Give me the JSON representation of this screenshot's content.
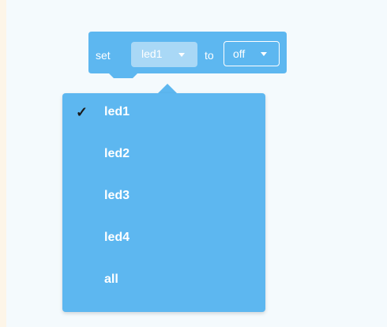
{
  "block": {
    "set_label": "set",
    "to_label": "to",
    "selected_value": "led1",
    "state_value": "off"
  },
  "dropdown": {
    "items": [
      {
        "label": "led1",
        "checked": true
      },
      {
        "label": "led2",
        "checked": false
      },
      {
        "label": "led3",
        "checked": false
      },
      {
        "label": "led4",
        "checked": false
      },
      {
        "label": "all",
        "checked": false
      }
    ],
    "check_glyph": "✓"
  },
  "colors": {
    "block": "#5db7f0",
    "selected_field": "#a9d8f6",
    "menu": "#5db7f0",
    "background": "#f4fafd"
  }
}
